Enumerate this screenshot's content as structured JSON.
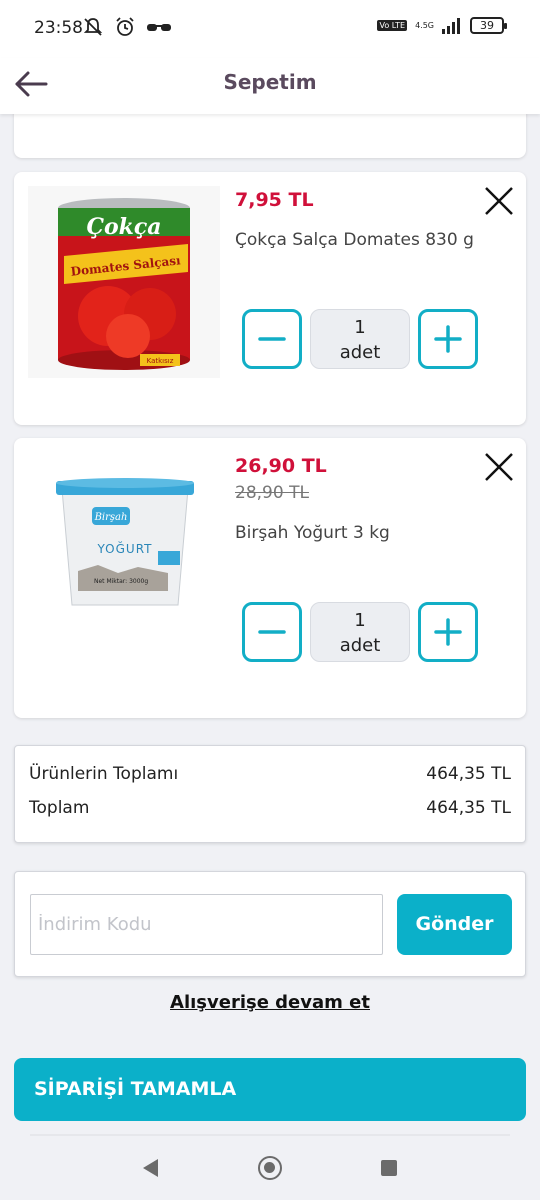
{
  "status": {
    "time": "23:58",
    "network": "4.5G",
    "volte": "Vo LTE",
    "battery": "39"
  },
  "header": {
    "title": "Sepetim"
  },
  "items": [
    {
      "price": "7,95 TL",
      "old_price": "",
      "name": "Çokça Salça Domates 830 g",
      "quantity": "1",
      "unit": "adet",
      "image_brand": "Çokça",
      "image_label": "Domates Salçası",
      "image_tag": "Katkısız"
    },
    {
      "price": "26,90 TL",
      "old_price": "28,90 TL",
      "name": "Birşah Yoğurt 3 kg",
      "quantity": "1",
      "unit": "adet",
      "image_brand": "Birşah",
      "image_label": "YOĞURT",
      "image_tag": "Net Miktar: 3000g"
    }
  ],
  "totals": {
    "subtotal_label": "Ürünlerin Toplamı",
    "subtotal_value": "464,35 TL",
    "total_label": "Toplam",
    "total_value": "464,35 TL"
  },
  "discount": {
    "placeholder": "İndirim Kodu",
    "value": "",
    "button_label": "Gönder"
  },
  "continue_label": "Alışverişe devam et",
  "checkout_label": "SİPARİŞİ TAMAMLA",
  "colors": {
    "accent": "#0bb0c9",
    "price": "#d0103a",
    "title": "#5a4a5e"
  }
}
